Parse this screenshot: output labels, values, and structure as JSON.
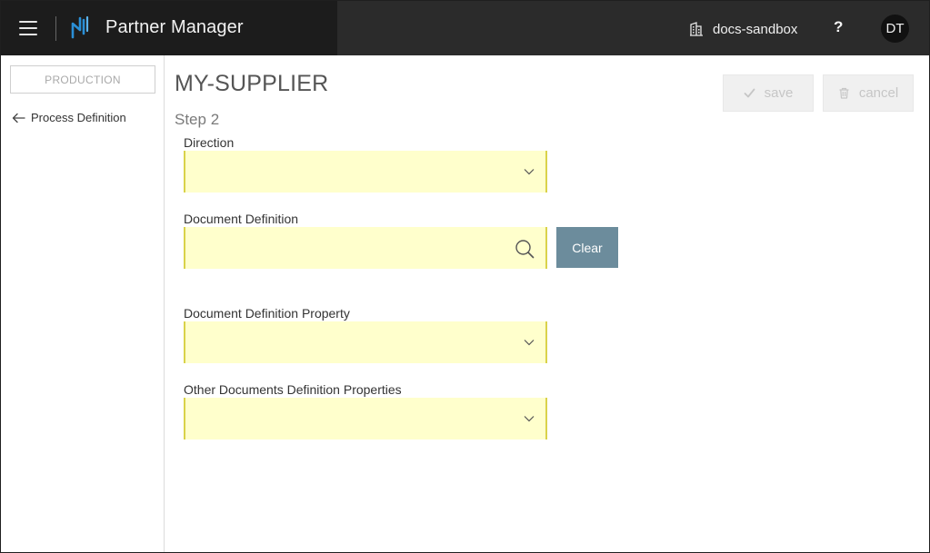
{
  "header": {
    "app_title": "Partner Manager",
    "tenant": "docs-sandbox",
    "help": "?",
    "avatar_initials": "DT",
    "colors": {
      "background": "#2b2b2b",
      "logo_accent": "#2a8fd6"
    }
  },
  "sidebar": {
    "environment": "PRODUCTION",
    "back_link": "Process Definition"
  },
  "main": {
    "title": "MY-SUPPLIER",
    "step": "Step 2",
    "buttons": {
      "save": "save",
      "cancel": "cancel",
      "clear": "Clear"
    },
    "fields": {
      "direction": {
        "label": "Direction",
        "value": ""
      },
      "document_definition": {
        "label": "Document Definition",
        "value": ""
      },
      "document_definition_property": {
        "label": "Document Definition Property",
        "value": ""
      },
      "other_properties": {
        "label": "Other Documents Definition Properties",
        "value": ""
      }
    },
    "colors": {
      "field_bg": "#ffffcc",
      "field_border": "#d9d24a",
      "clear_button": "#6c8c9c"
    }
  }
}
